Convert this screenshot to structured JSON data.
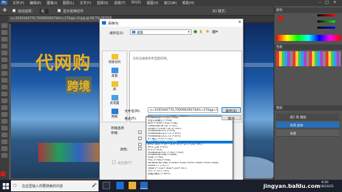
{
  "menubar": {
    "items": [
      "文件(F)",
      "编辑(E)",
      "图像(I)",
      "图层(L)",
      "文字(Y)",
      "选择(S)",
      "滤镜(T)",
      "3D(D)",
      "视图(V)",
      "窗口(W)",
      "帮助(H)"
    ]
  },
  "options": {
    "auto_select": "自动选择：",
    "group": "组",
    "show_transform": "显示变换控件",
    "mode3d": "3D 模式："
  },
  "document": {
    "tab": "u=3165444770,7000663927&fm=27&gp=0.jpg @ 66.7% (RGB/8)"
  },
  "artwork": {
    "title": "代网购",
    "subtitle": "跨境"
  },
  "dialog": {
    "title": "另存为",
    "save_in_label": "保存在(I):",
    "save_in_value": "桌面",
    "empty_text": "没有与搜索条件匹配的项。",
    "places": [
      "快速访问",
      "桌面",
      "库",
      "此电脑",
      "网络"
    ],
    "filename_label": "文件名(N):",
    "filename_value": "u=3165444770,7000663927&fm=27&gp=0",
    "format_label": "格式(F):",
    "format_value": "Photoshop (*.PSD;*.PDD)",
    "save_button": "保存(S)",
    "cancel_button": "取消",
    "save_options_label": "存储选项",
    "store_label": "存储:",
    "color_label": "颜色:",
    "thumbnail_label": "缩览图(T)"
  },
  "format_options": [
    "Photoshop (*.PSD;*.PDD)",
    "大型文档格式 (*.PSB)",
    "BMP (*.BMP;*.RLE;*.DIB)",
    "CompuServe GIF (*.GIF)",
    "Dicom (*.DCM;*.DC3;*.DIC)",
    "Photoshop EPS (*.EPS)",
    "Photoshop DCS 1.0 (*.EPS)",
    "Photoshop DCS 2.0 (*.EPS)",
    "IFF 格式 (*.IFF;*.TDI)",
    "JPEG (*.JPG;*.JPEG;*.JPE)",
    "JPEG 2000 (*.JPF;*.JPX;*.JP2;*.J2C;*.J2K;*.JPC)",
    "JPEG 立体 (*.JPS)",
    "PCX (*.PCX)",
    "Photoshop PDF (*.PDF;*.PDP)",
    "Photoshop Raw (*.RAW)",
    "Pixar (*.PXR)",
    "PNG (*.PNG;*.PNS)",
    "Portable Bit Map (*.PBM;*.PGM;*.PPM;*.PNM;*.PFM;*.PAM)",
    "Scitex CT (*.SCT)",
    "Targa (*.TGA;*.VDA;*.ICB;*.VST)",
    "TIFF (*.TIF;*.TIFF)",
    "多图片格式 (*.MPO)"
  ],
  "selected_format_index": 9,
  "panels": {
    "color": "颜色",
    "swatches": "色板",
    "layers": "图层",
    "channels": "通道",
    "paths": "路径",
    "layer_rows": [
      "背景 副本",
      "背景"
    ],
    "layer_top_label": "组1 的 图层"
  },
  "colors": {
    "foreground": "#cc1c1c",
    "background": "#ffffff",
    "accent": "#0078d7"
  },
  "taskbar": {
    "search_placeholder": "在这里输入你要搜索的内容",
    "time": "9:20",
    "date": "2018/10/21"
  },
  "watermark": "jingyan.baidu.com"
}
